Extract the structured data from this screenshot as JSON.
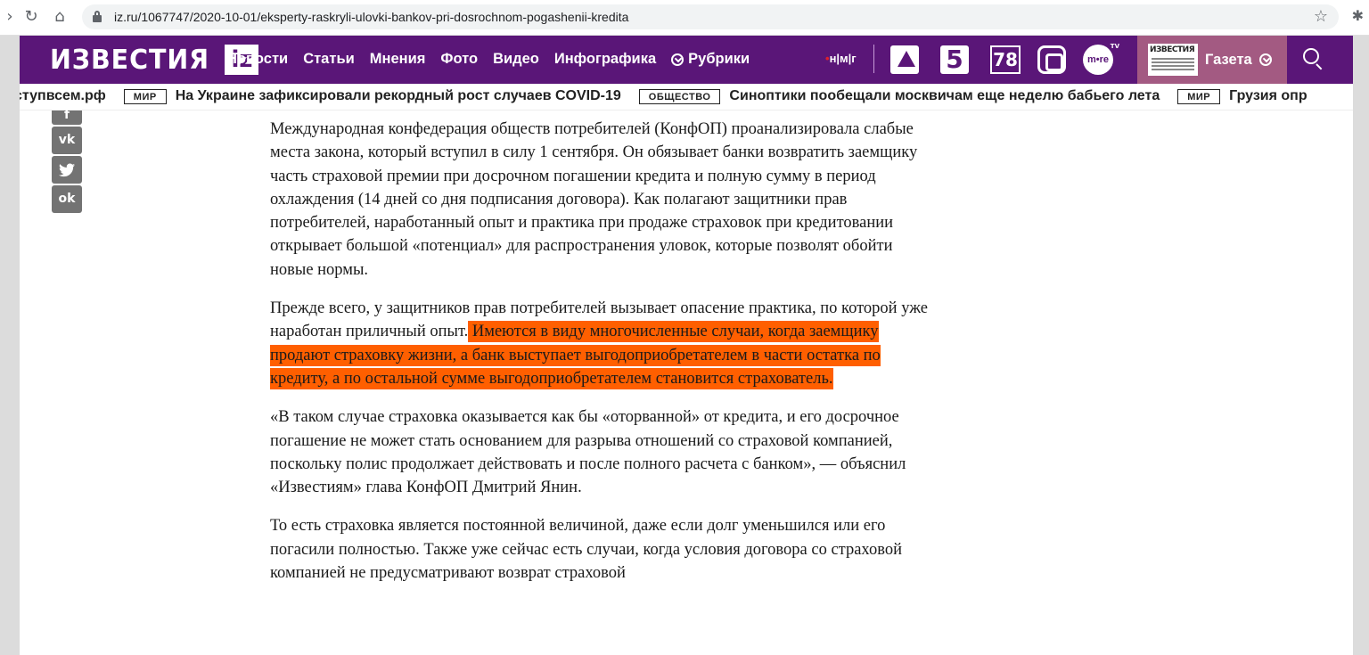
{
  "browser": {
    "url": "iz.ru/1067747/2020-10-01/eksperty-raskryli-ulovki-bankov-pri-dosrochnom-pogashenii-kredita"
  },
  "header": {
    "logo_text": "ИЗВЕСТИЯ",
    "logo_badge": "iz",
    "nav": [
      "Новости",
      "Статьи",
      "Мнения",
      "Фото",
      "Видео",
      "Инфографика"
    ],
    "rubrics_label": "Рубрики",
    "nmg": "н|м|г",
    "channels": {
      "ch5": "5",
      "ch78": "78",
      "more": "m•re",
      "more_tv": "TV"
    },
    "gazeta_label": "Газета"
  },
  "ticker": {
    "lead_text": "ступвсем.рф",
    "items": [
      {
        "badge": "МИР",
        "text": "На Украине зафиксировали рекордный рост случаев COVID-19"
      },
      {
        "badge": "ОБЩЕСТВО",
        "text": "Синоптики пообещали москвичам еще неделю бабьего лета"
      },
      {
        "badge": "МИР",
        "text": "Грузия опр"
      }
    ]
  },
  "share": {
    "vk": "vk",
    "twitter": "t",
    "ok": "ok"
  },
  "article": {
    "p1": "Международная конфедерация обществ потребителей (КонфОП) проанализировала слабые места закона, который вступил в силу 1 сентября. Он обязывает банки возвратить заемщику часть страховой премии при досрочном погашении кредита и полную сумму в период охлаждения (14 дней со дня подписания договора). Как полагают защитники прав потребителей, наработанный опыт и практика при продаже страховок при кредитовании открывает большой «потенциал» для распространения уловок, которые позволят обойти новые нормы.",
    "p2_plain": "Прежде всего, у защитников прав потребителей вызывает опасение практика, по которой уже наработан приличный опыт.",
    "p2_highlight": " Имеются в виду многочисленные случаи, когда заемщику продают страховку жизни, а банк выступает выгодоприобретателем в части остатка по кредиту, а по остальной сумме выгодоприобретателем становится страхователь.",
    "p3": "«В таком случае страховка оказывается как бы «оторванной» от кредита, и его досрочное погашение не может стать основанием для разрыва отношений со страховой компанией, поскольку полис продолжает действовать и после полного расчета с банком», — объяснил «Известиям» глава КонфОП Дмитрий Янин.",
    "p4": "То есть страховка является постоянной величиной, даже если долг уменьшился или его погасили полностью. Также уже сейчас есть случаи, когда условия договора со страховой компанией не предусматривают возврат страховой"
  },
  "colors": {
    "header_bg": "#5a1678",
    "gazeta_bg": "#a35a82",
    "highlight": "#ff5f00",
    "share_btn": "#737373"
  }
}
